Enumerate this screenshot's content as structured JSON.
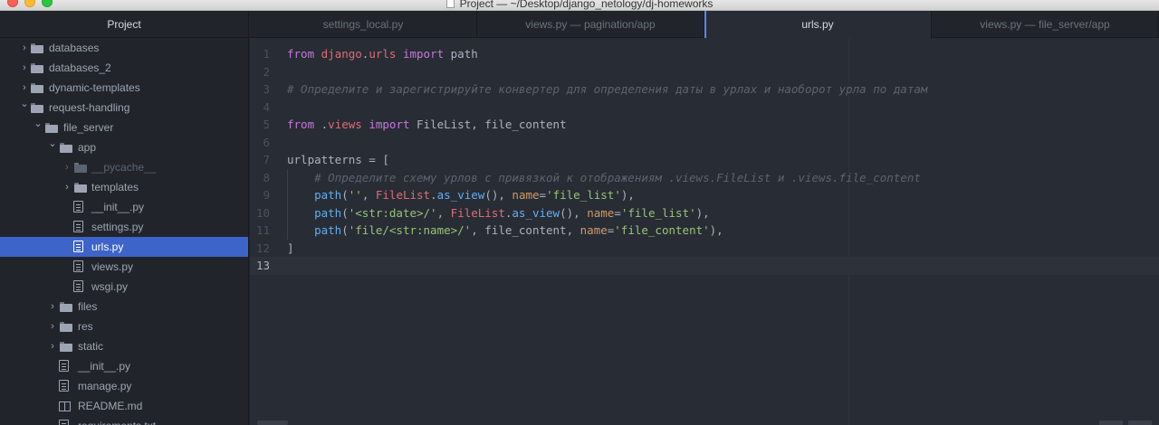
{
  "window": {
    "title": "Project — ~/Desktop/django_netology/dj-homeworks"
  },
  "sidebar": {
    "header": "Project",
    "items": [
      {
        "label": "databases",
        "type": "folder",
        "expanded": false,
        "depth": 0
      },
      {
        "label": "databases_2",
        "type": "folder",
        "expanded": false,
        "depth": 0
      },
      {
        "label": "dynamic-templates",
        "type": "folder",
        "expanded": false,
        "depth": 0
      },
      {
        "label": "request-handling",
        "type": "folder",
        "expanded": true,
        "depth": 0
      },
      {
        "label": "file_server",
        "type": "folder",
        "expanded": true,
        "depth": 1
      },
      {
        "label": "app",
        "type": "folder",
        "expanded": true,
        "depth": 2
      },
      {
        "label": "__pycache__",
        "type": "folder",
        "expanded": false,
        "depth": 3,
        "dim": true
      },
      {
        "label": "templates",
        "type": "folder",
        "expanded": false,
        "depth": 3
      },
      {
        "label": "__init__.py",
        "type": "file",
        "depth": 3
      },
      {
        "label": "settings.py",
        "type": "file",
        "depth": 3
      },
      {
        "label": "urls.py",
        "type": "file",
        "depth": 3,
        "selected": true
      },
      {
        "label": "views.py",
        "type": "file",
        "depth": 3
      },
      {
        "label": "wsgi.py",
        "type": "file",
        "depth": 3
      },
      {
        "label": "files",
        "type": "folder",
        "expanded": false,
        "depth": 2
      },
      {
        "label": "res",
        "type": "folder",
        "expanded": false,
        "depth": 2
      },
      {
        "label": "static",
        "type": "folder",
        "expanded": false,
        "depth": 2
      },
      {
        "label": "__init__.py",
        "type": "file",
        "depth": 2
      },
      {
        "label": "manage.py",
        "type": "file",
        "depth": 2
      },
      {
        "label": "README.md",
        "type": "book",
        "depth": 2
      },
      {
        "label": "requirements.txt",
        "type": "file",
        "depth": 2
      }
    ]
  },
  "tabs": [
    {
      "label": "settings_local.py",
      "active": false
    },
    {
      "label": "views.py — pagination/app",
      "active": false
    },
    {
      "label": "urls.py",
      "active": true
    },
    {
      "label": "views.py — file_server/app",
      "active": false
    }
  ],
  "editor": {
    "cursor_line": 13,
    "lines": [
      [
        [
          "kw",
          "from"
        ],
        [
          "",
          " "
        ],
        [
          "mod",
          "django"
        ],
        [
          "",
          "."
        ],
        [
          "mod",
          "urls"
        ],
        [
          "",
          " "
        ],
        [
          "kw",
          "import"
        ],
        [
          "",
          " path"
        ]
      ],
      [],
      [
        [
          "cm",
          "# Определите и зарегистрируйте конвертер для определения даты в урлах и наоборот урла по датам"
        ]
      ],
      [],
      [
        [
          "kw",
          "from"
        ],
        [
          "",
          " ."
        ],
        [
          "mod",
          "views"
        ],
        [
          "",
          " "
        ],
        [
          "kw",
          "import"
        ],
        [
          "",
          " FileList, file_content"
        ]
      ],
      [],
      [
        [
          "",
          "urlpatterns = ["
        ]
      ],
      [
        [
          "",
          "    "
        ],
        [
          "cm",
          "# Определите схему урлов с привязкой к отображениям .views.FileList и .views.file_content"
        ]
      ],
      [
        [
          "",
          "    "
        ],
        [
          "fn",
          "path"
        ],
        [
          "",
          "("
        ],
        [
          "str",
          "''"
        ],
        [
          "",
          ", "
        ],
        [
          "cls",
          "FileList"
        ],
        [
          "",
          "."
        ],
        [
          "fn",
          "as_view"
        ],
        [
          "",
          "(), "
        ],
        [
          "param",
          "name"
        ],
        [
          "",
          "="
        ],
        [
          "str",
          "'file_list'"
        ],
        [
          "",
          "),"
        ]
      ],
      [
        [
          "",
          "    "
        ],
        [
          "fn",
          "path"
        ],
        [
          "",
          "("
        ],
        [
          "str",
          "'<str:date>/'"
        ],
        [
          "",
          ", "
        ],
        [
          "cls",
          "FileList"
        ],
        [
          "",
          "."
        ],
        [
          "fn",
          "as_view"
        ],
        [
          "",
          "(), "
        ],
        [
          "param",
          "name"
        ],
        [
          "",
          "="
        ],
        [
          "str",
          "'file_list'"
        ],
        [
          "",
          "),"
        ]
      ],
      [
        [
          "",
          "    "
        ],
        [
          "fn",
          "path"
        ],
        [
          "",
          "("
        ],
        [
          "str",
          "'file/<str:name>/'"
        ],
        [
          "",
          ", file_content, "
        ],
        [
          "param",
          "name"
        ],
        [
          "",
          "="
        ],
        [
          "str",
          "'file_content'"
        ],
        [
          "",
          "),"
        ]
      ],
      [
        [
          "",
          "]"
        ]
      ],
      []
    ]
  }
}
